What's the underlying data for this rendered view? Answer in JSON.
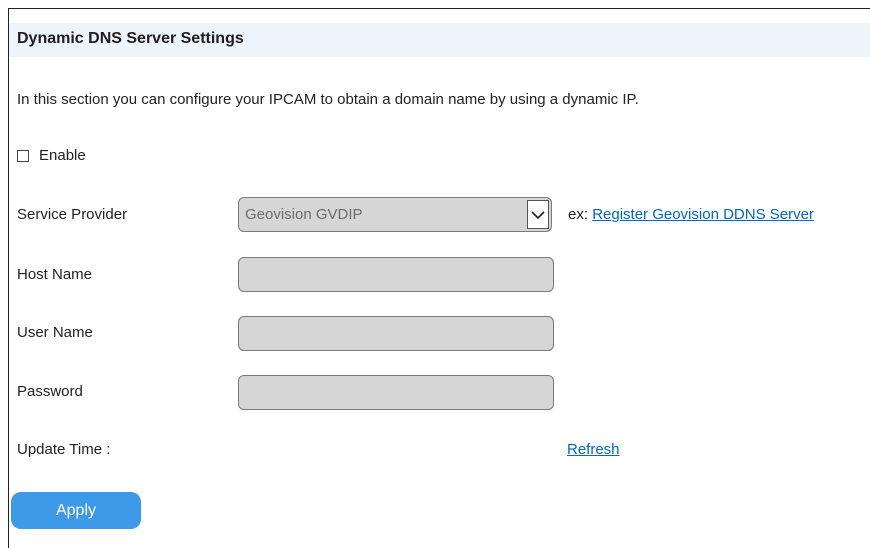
{
  "header": {
    "title": "Dynamic DNS Server Settings"
  },
  "description": "In this section you can configure your IPCAM to obtain a domain name by using a dynamic IP.",
  "enable": {
    "label": "Enable",
    "checked": false
  },
  "service_provider": {
    "label": "Service Provider",
    "selected": "Geovision GVDIP",
    "ex_prefix": "ex:",
    "register_link": "Register Geovision DDNS Server"
  },
  "host_name": {
    "label": "Host Name",
    "value": ""
  },
  "user_name": {
    "label": "User Name",
    "value": ""
  },
  "password": {
    "label": "Password",
    "value": ""
  },
  "update_time": {
    "label": "Update Time :",
    "refresh_link": "Refresh"
  },
  "apply_button": "Apply",
  "colors": {
    "header_bg": "#eef4fb",
    "link": "#0066cc",
    "button": "#3d9ae8",
    "field_bg": "#d6d6d6"
  }
}
